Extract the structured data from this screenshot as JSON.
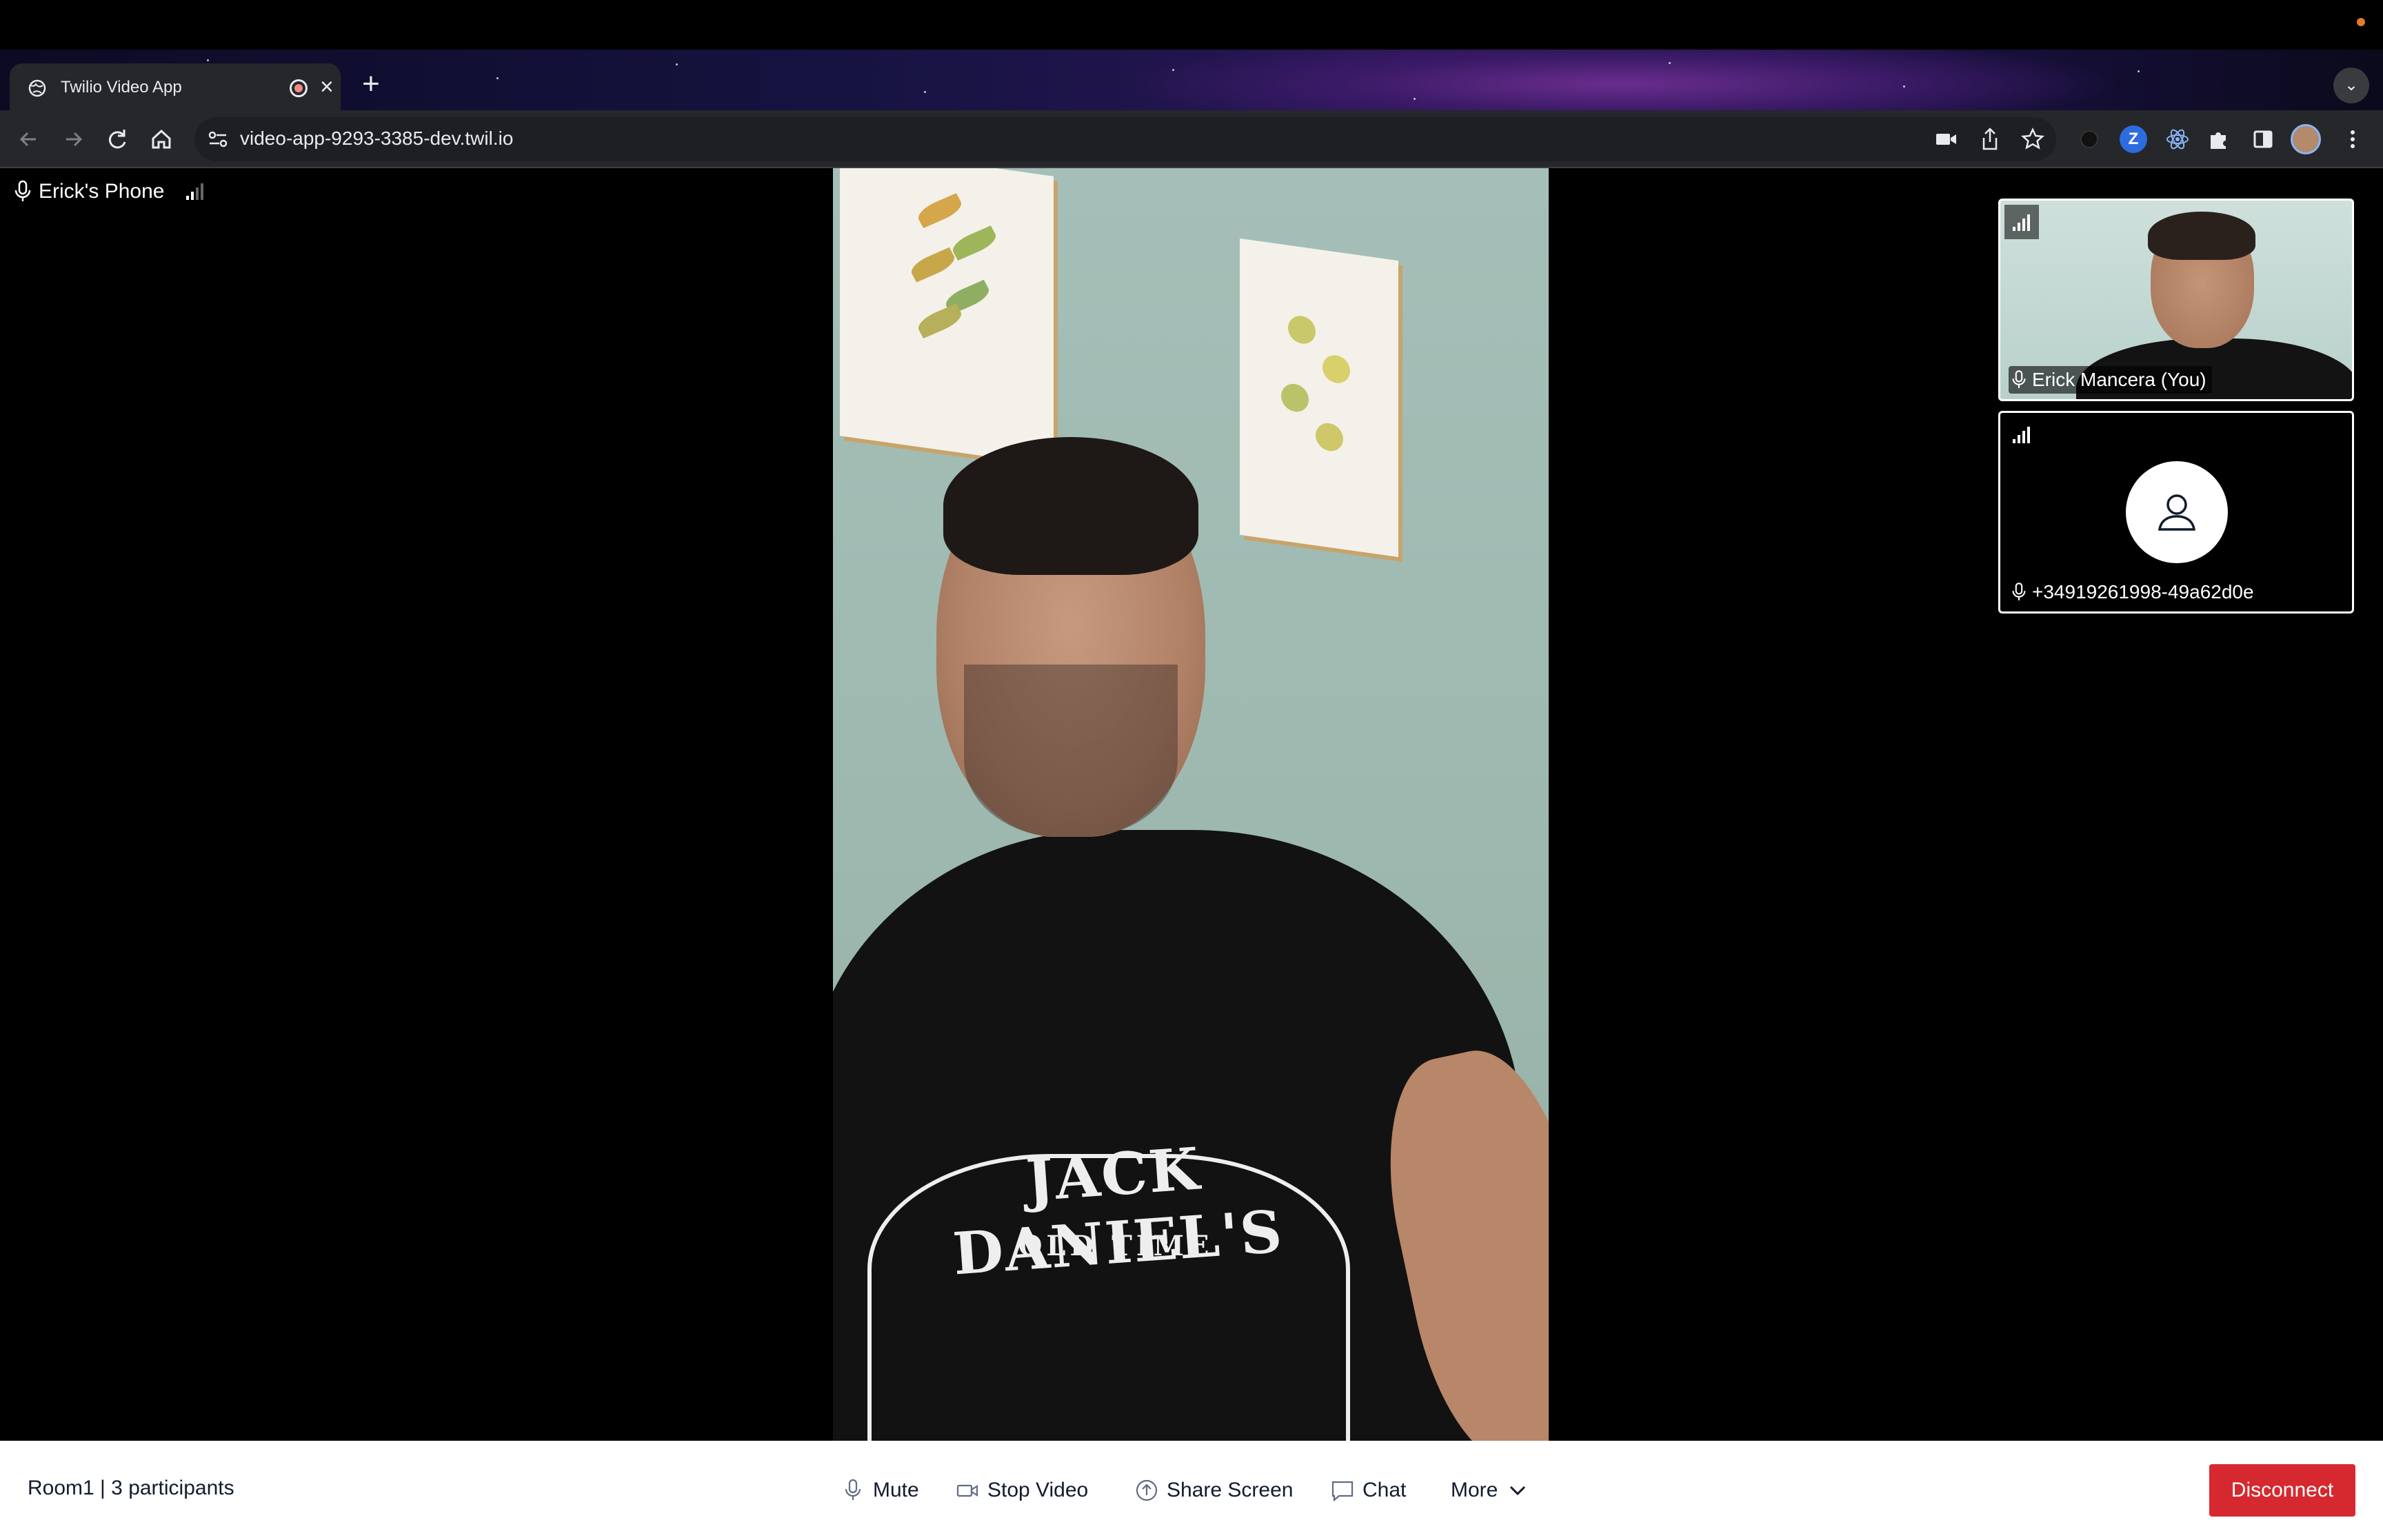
{
  "browser": {
    "tab_title": "Twilio Video App",
    "url": "video-app-9293-3385-dev.twil.io",
    "extension_letter": "Z"
  },
  "main": {
    "participant_name": "Erick's Phone"
  },
  "thumbnails": [
    {
      "name": "Erick Mancera (You)"
    },
    {
      "name": "+34919261998-49a62d0e"
    }
  ],
  "shirt": {
    "line1": "JACK DANIEL'S",
    "line2": "OLD TIME"
  },
  "controls": {
    "room_info": "Room1 | 3 participants",
    "mute_label": "Mute",
    "stop_video_label": "Stop Video",
    "share_screen_label": "Share Screen",
    "chat_label": "Chat",
    "more_label": "More",
    "disconnect_label": "Disconnect"
  },
  "colors": {
    "disconnect": "#d6292f",
    "control_bar": "#ffffff",
    "chrome_toolbar": "#26272b"
  }
}
